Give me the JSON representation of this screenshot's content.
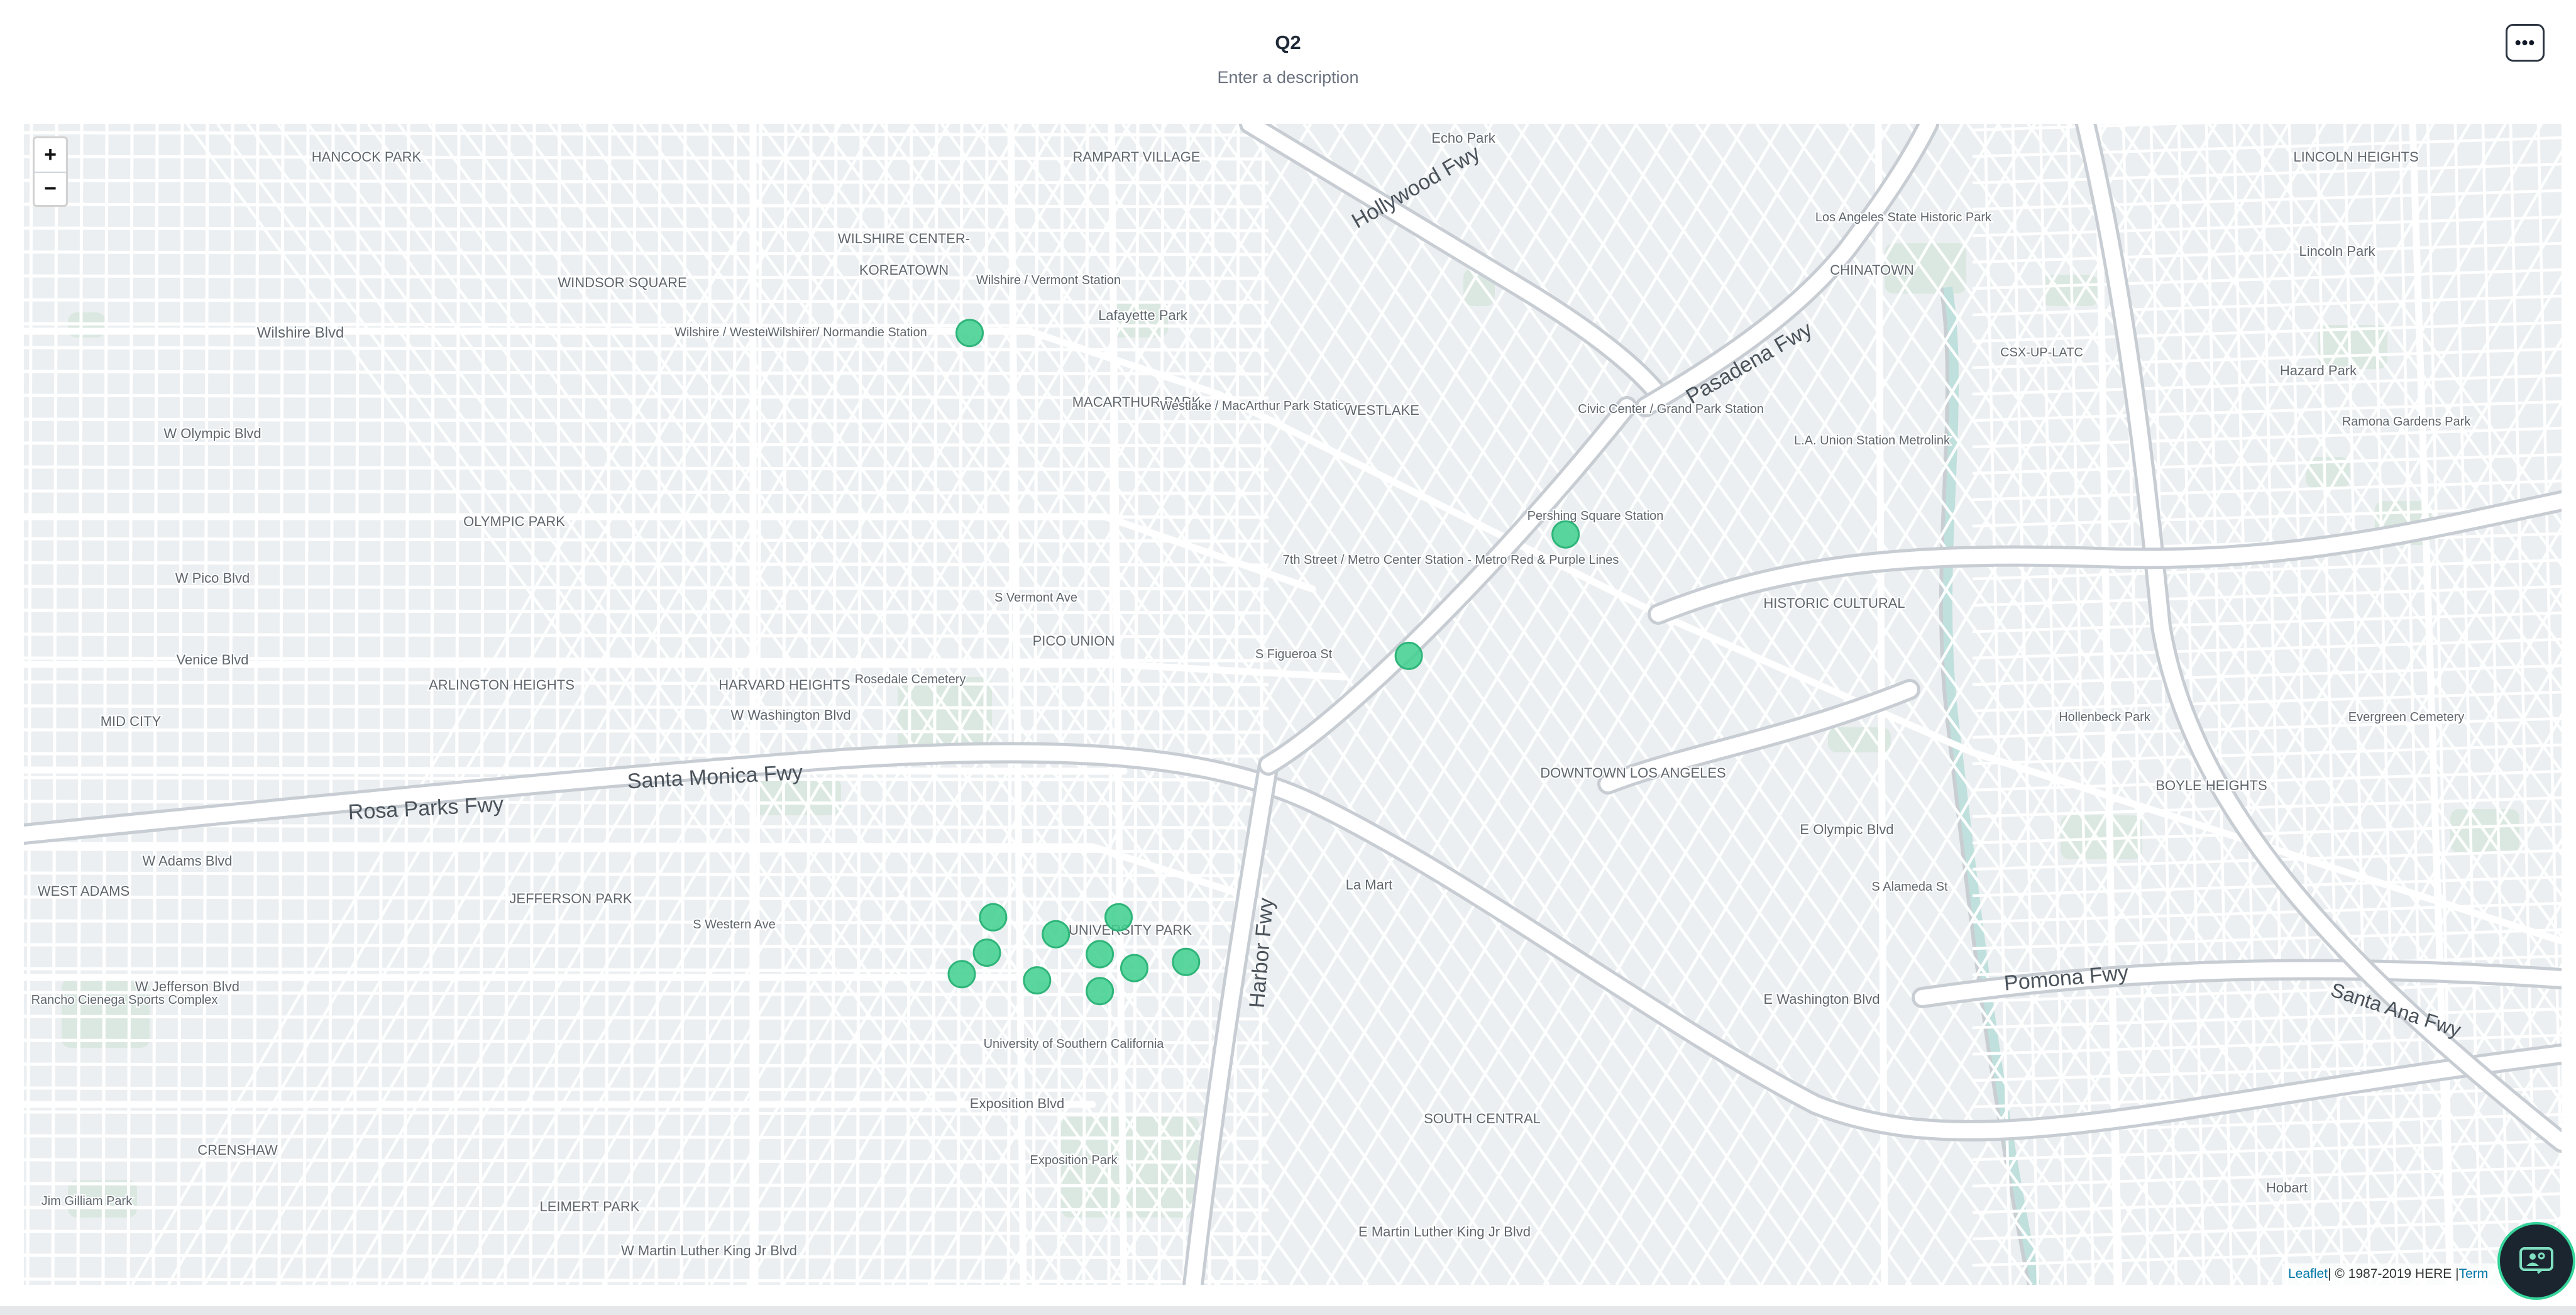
{
  "header": {
    "title": "Q2",
    "description_placeholder": "Enter a description",
    "more_label": "•••"
  },
  "map": {
    "zoom_in_label": "+",
    "zoom_out_label": "−",
    "attribution_link": "Leaflet",
    "attribution_text": " | © 1987-2019 HERE | ",
    "attribution_terms": "Term",
    "marker_color": "#3ecf8e",
    "water_color": "#bfe0dc",
    "park_color": "#dbe8e1",
    "freeways": [
      {
        "name": "Hollywood Fwy"
      },
      {
        "name": "Pasadena Fwy"
      },
      {
        "name": "Santa Monica Fwy"
      },
      {
        "name": "Rosa Parks Fwy"
      },
      {
        "name": "Harbor Fwy"
      },
      {
        "name": "Pomona Fwy"
      },
      {
        "name": "Santa Ana Fwy"
      }
    ],
    "labels": [
      {
        "text": "HANCOCK PARK"
      },
      {
        "text": "KOREATOWN"
      },
      {
        "text": "WILSHIRE CENTER-"
      },
      {
        "text": "RAMPART VILLAGE"
      },
      {
        "text": "Echo Park"
      },
      {
        "text": "WINDSOR SQUARE"
      },
      {
        "text": "Wilshire / Vermont Station"
      },
      {
        "text": "Lafayette Park"
      },
      {
        "text": "Wilshire / Western Station"
      },
      {
        "text": "Wilshire / Normandie Station"
      },
      {
        "text": "MACARTHUR PARK"
      },
      {
        "text": "Westlake / MacArthur Park Station"
      },
      {
        "text": "WESTLAKE"
      },
      {
        "text": "Civic Center / Grand Park Station"
      },
      {
        "text": "CHINATOWN"
      },
      {
        "text": "Los Angeles State Historic Park"
      },
      {
        "text": "L.A. Union Station Metrolink"
      },
      {
        "text": "LINCOLN HEIGHTS"
      },
      {
        "text": "Lincoln Park"
      },
      {
        "text": "CSX-UP-LATC"
      },
      {
        "text": "Hazard Park"
      },
      {
        "text": "Ramona Gardens Park"
      },
      {
        "text": "OLYMPIC PARK"
      },
      {
        "text": "Pershing Square Station"
      },
      {
        "text": "7th Street / Metro Center Station - Metro Red & Purple Lines"
      },
      {
        "text": "PICO UNION"
      },
      {
        "text": "HISTORIC CULTURAL"
      },
      {
        "text": "ARLINGTON HEIGHTS"
      },
      {
        "text": "HARVARD HEIGHTS"
      },
      {
        "text": "Rosedale Cemetery"
      },
      {
        "text": "MID CITY"
      },
      {
        "text": "Hollenbeck Park"
      },
      {
        "text": "Evergreen Cemetery"
      },
      {
        "text": "DOWNTOWN LOS ANGELES"
      },
      {
        "text": "BOYLE HEIGHTS"
      },
      {
        "text": "WEST ADAMS"
      },
      {
        "text": "JEFFERSON PARK"
      },
      {
        "text": "La Mart"
      },
      {
        "text": "UNIVERSITY PARK"
      },
      {
        "text": "Rancho Cienega Sports Complex"
      },
      {
        "text": "University of Southern California"
      },
      {
        "text": "Exposition Park"
      },
      {
        "text": "CRENSHAW"
      },
      {
        "text": "LEIMERT PARK"
      },
      {
        "text": "SOUTH CENTRAL"
      },
      {
        "text": "Jim Gilliam Park"
      },
      {
        "text": "Wilshire Blvd"
      },
      {
        "text": "W Olympic Blvd"
      },
      {
        "text": "W Pico Blvd"
      },
      {
        "text": "Venice Blvd"
      },
      {
        "text": "W Washington Blvd"
      },
      {
        "text": "W Adams Blvd"
      },
      {
        "text": "W Jefferson Blvd"
      },
      {
        "text": "Exposition Blvd"
      },
      {
        "text": "S Western Ave"
      },
      {
        "text": "S Vermont Ave"
      },
      {
        "text": "S Figueroa St"
      },
      {
        "text": "E Washington Blvd"
      },
      {
        "text": "E Olympic Blvd"
      },
      {
        "text": "S Alameda St"
      },
      {
        "text": "W Martin Luther King Jr Blvd"
      },
      {
        "text": "E Martin Luther King Jr Blvd"
      },
      {
        "text": "Hobart"
      }
    ],
    "markers": [
      {
        "lat": 34.0623,
        "lng": -118.2915
      },
      {
        "lat": 34.0492,
        "lng": -118.2535
      },
      {
        "lat": 34.0413,
        "lng": -118.2635
      },
      {
        "lat": 34.0243,
        "lng": -118.29
      },
      {
        "lat": 34.0243,
        "lng": -118.282
      },
      {
        "lat": 34.0232,
        "lng": -118.286
      },
      {
        "lat": 34.022,
        "lng": -118.2904
      },
      {
        "lat": 34.0219,
        "lng": -118.2832
      },
      {
        "lat": 34.0214,
        "lng": -118.2777
      },
      {
        "lat": 34.021,
        "lng": -118.281
      },
      {
        "lat": 34.0206,
        "lng": -118.292
      },
      {
        "lat": 34.0202,
        "lng": -118.2872
      },
      {
        "lat": 34.0195,
        "lng": -118.2832
      }
    ]
  }
}
